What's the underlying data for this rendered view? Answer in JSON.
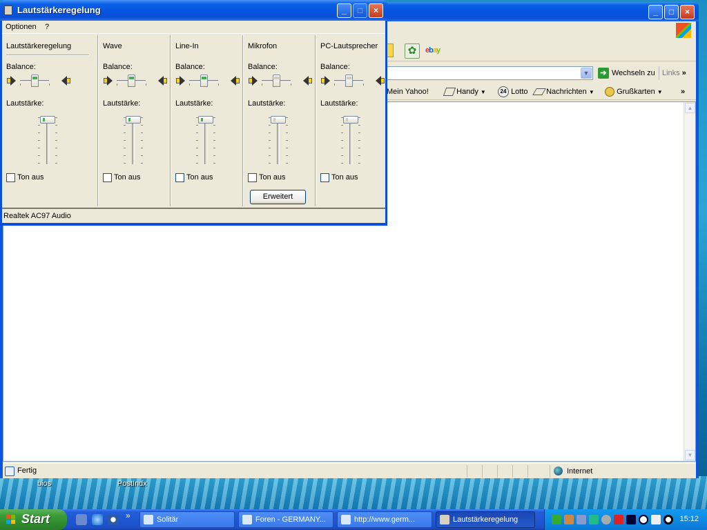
{
  "desktop": {
    "icons": [
      "bios",
      "PostIndx"
    ]
  },
  "browser": {
    "links_bar": [
      "Mein Yahoo!",
      "Handy",
      "Lotto",
      "Nachrichten",
      "Grußkarten"
    ],
    "go_label": "Wechseln zu",
    "links_label": "Links",
    "status_text": "Fertig",
    "zone_text": "Internet",
    "lotto_badge": "24",
    "chevron": "»"
  },
  "volume": {
    "title": "Lautstärkeregelung",
    "menu": [
      "Optionen",
      "?"
    ],
    "balance_label": "Balance:",
    "volume_label": "Lautstärke:",
    "mute_label": "Ton aus",
    "advanced_label": "Erweitert",
    "device": "Realtek AC97 Audio",
    "channels": [
      {
        "name": "Lautstärkeregelung",
        "balance": 0.0,
        "volume": 1.0,
        "muted": false,
        "enabled": true
      },
      {
        "name": "Wave",
        "balance": 0.0,
        "volume": 1.0,
        "muted": false,
        "enabled": true
      },
      {
        "name": "Line-In",
        "balance": 0.0,
        "volume": 1.0,
        "muted": false,
        "enabled": true
      },
      {
        "name": "Mikrofon",
        "balance": 0.0,
        "volume": 1.0,
        "muted": false,
        "enabled": false
      },
      {
        "name": "PC-Lautsprecher",
        "balance": 0.0,
        "volume": 1.0,
        "muted": false,
        "enabled": false
      }
    ]
  },
  "taskbar": {
    "start_label": "Start",
    "tasks": [
      "Solitär",
      "Foren - GERMANY...",
      "http://www.germ...",
      "Lautstärkeregelung"
    ],
    "clock": "15:12"
  },
  "colors": {
    "accent_green": "#44b24a",
    "xp_blue": "#0a56e0",
    "start_green": "#3b9c39"
  }
}
